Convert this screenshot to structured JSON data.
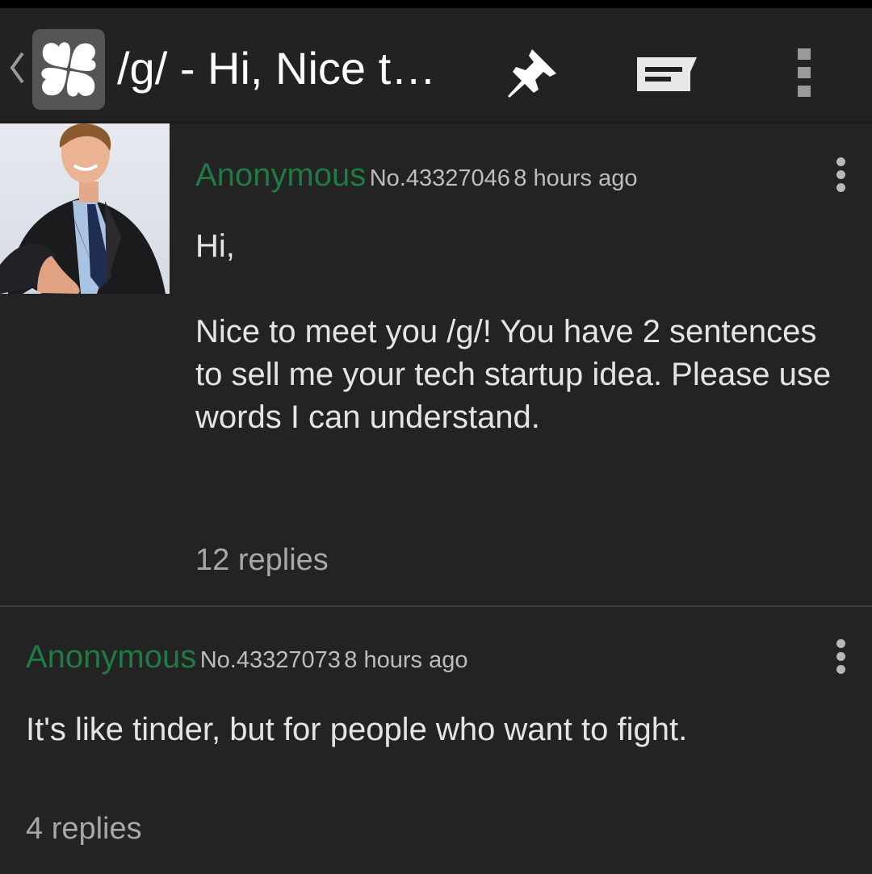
{
  "actionbar": {
    "title": "/g/ - Hi,  Nice t…",
    "up_icon": "chevron-left-icon",
    "logo_icon": "clover-icon",
    "pin_icon": "pin-icon",
    "reply_icon": "reply-icon",
    "overflow_icon": "overflow-menu-icon"
  },
  "posts": [
    {
      "name": "Anonymous",
      "number": "No.43327046",
      "time": "8 hours ago",
      "comment": "Hi,\n\nNice to meet you /g/! You have 2 sentences to sell me your tech startup idea. Please use words I can understand.",
      "replies": "12 replies",
      "menu_icon": "overflow-menu-icon"
    },
    {
      "name": "Anonymous",
      "number": "No.43327073",
      "time": "8 hours ago",
      "comment": "It's like tinder, but for people who want to fight.",
      "replies": "4 replies",
      "menu_icon": "overflow-menu-icon"
    }
  ],
  "colors": {
    "background": "#232323",
    "name": "#1f7a43",
    "text": "#e4e4e4",
    "meta": "#bdbdbd"
  }
}
